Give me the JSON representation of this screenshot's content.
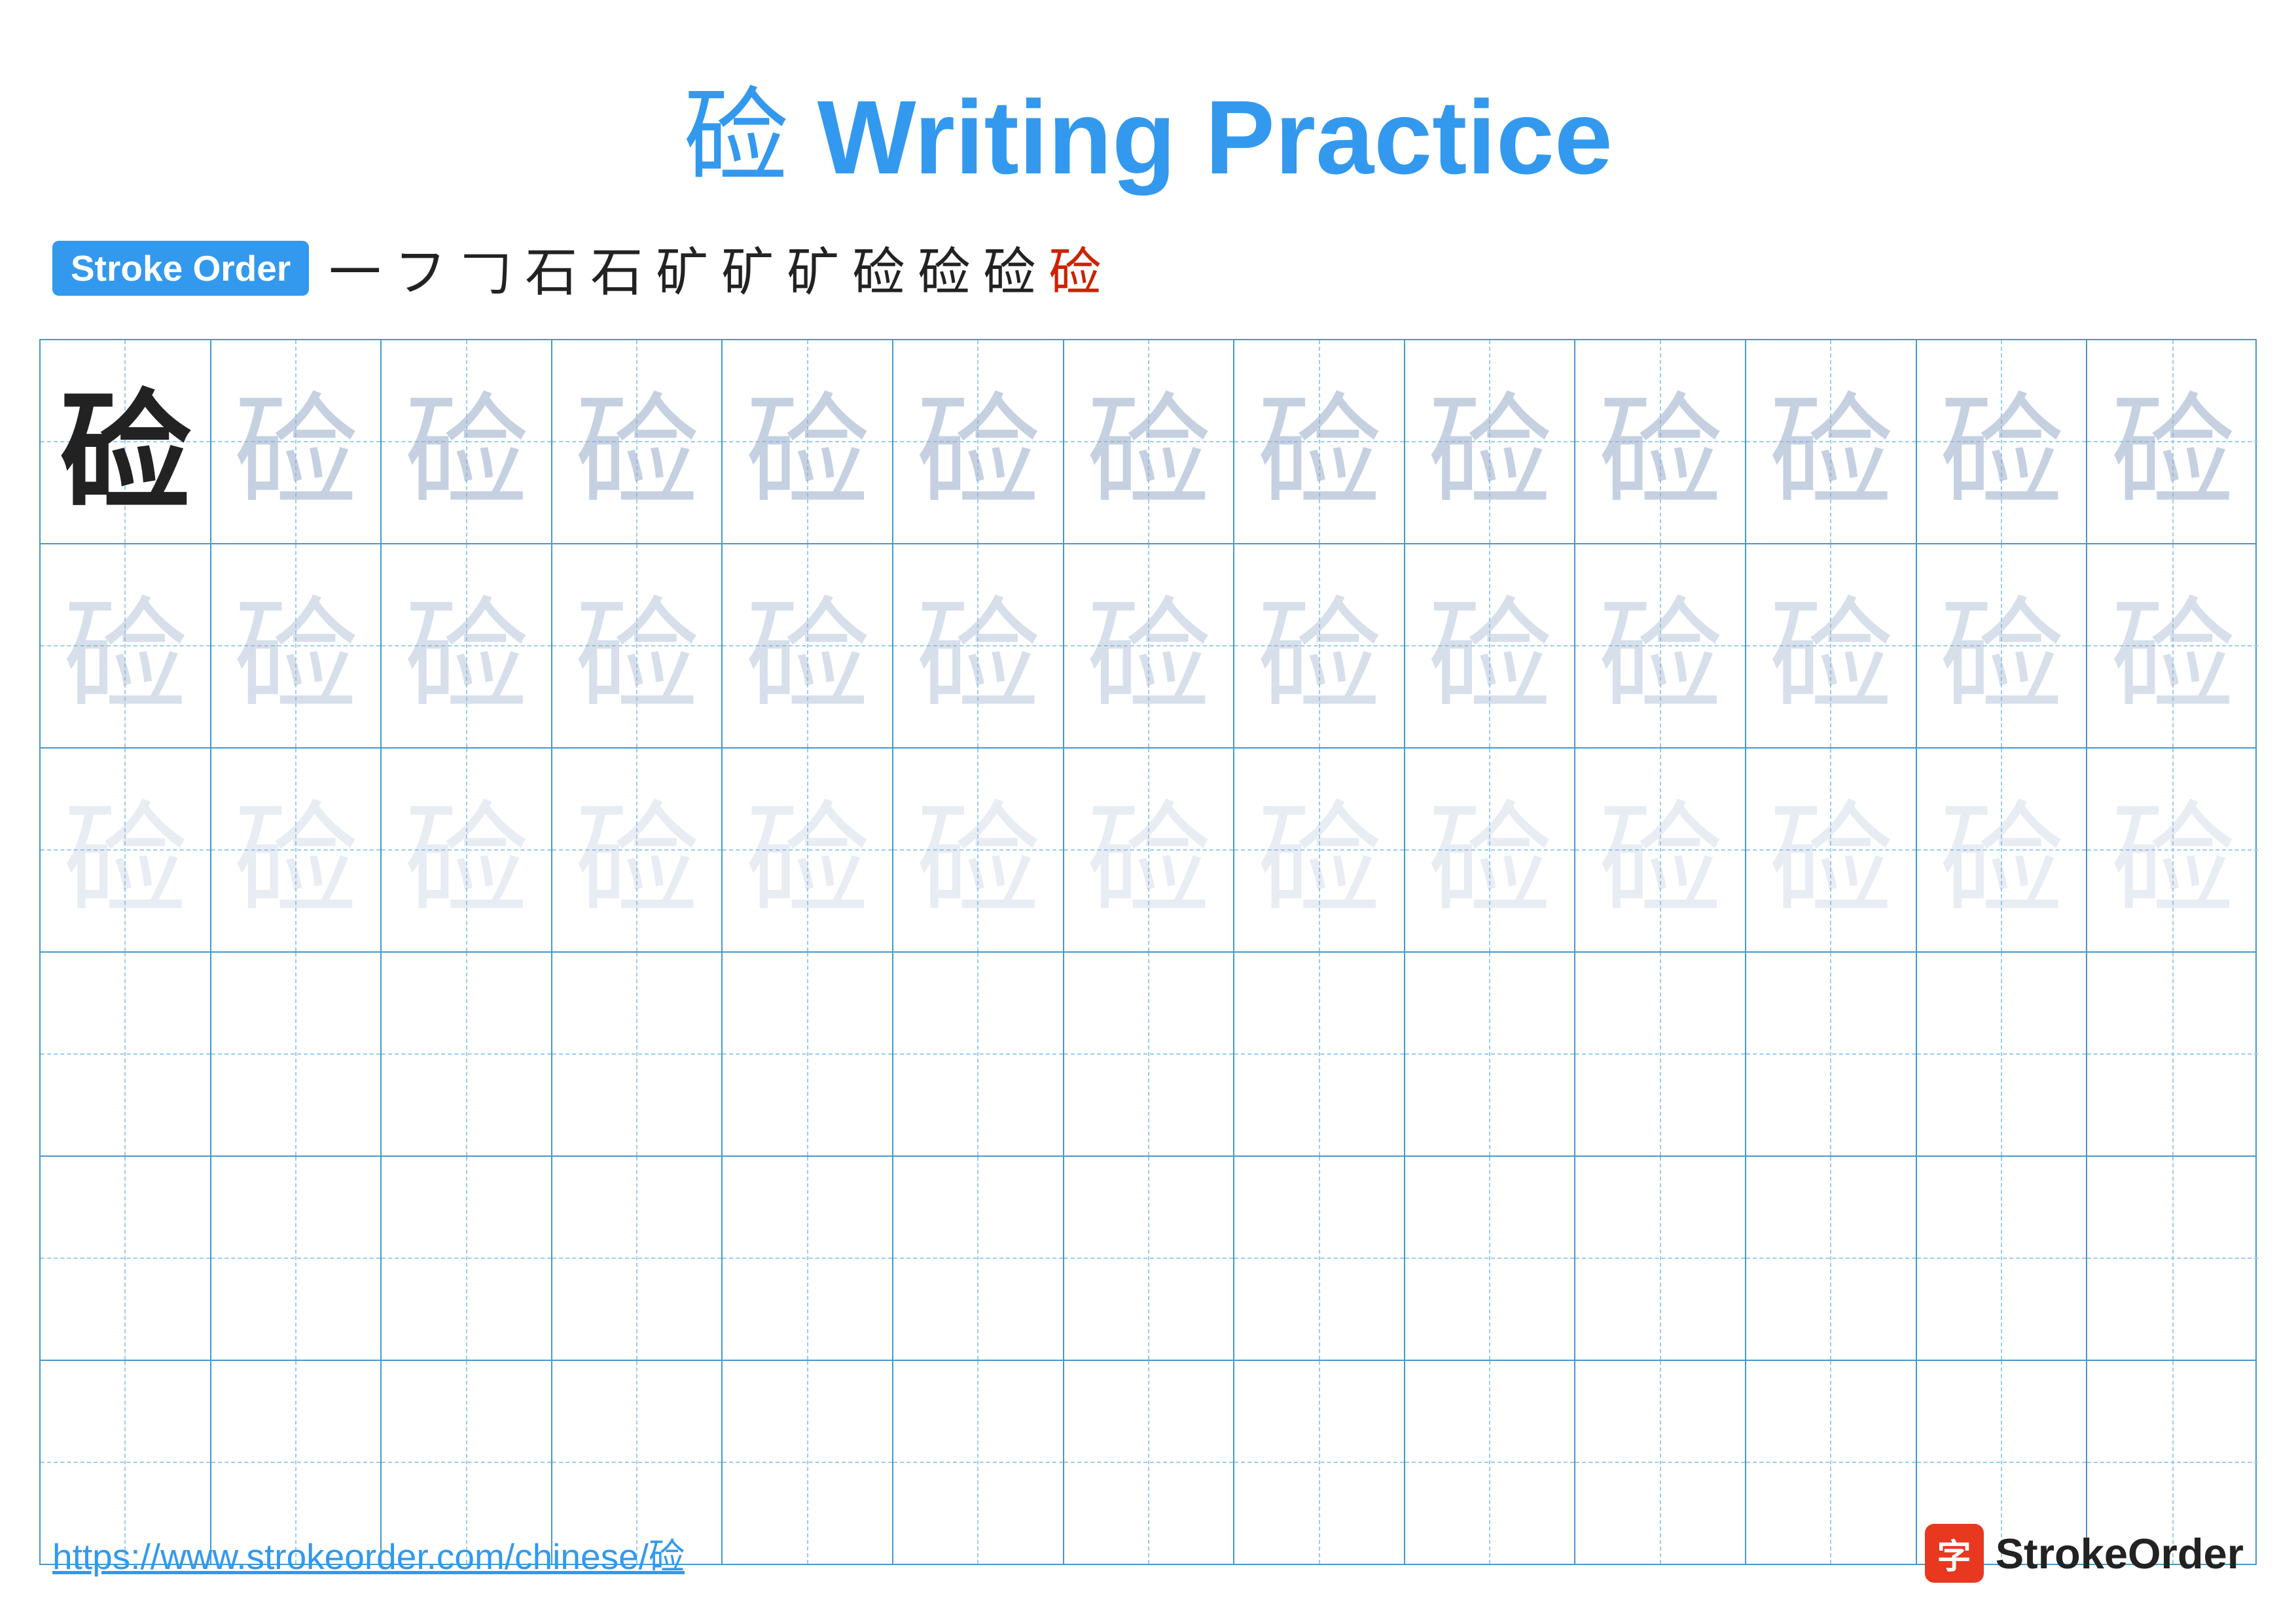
{
  "title": {
    "char": "硷",
    "text": " Writing Practice"
  },
  "stroke_order": {
    "badge_label": "Stroke Order",
    "strokes": [
      "一",
      "フ",
      "𠃌",
      "石",
      "石",
      "矿",
      "矿",
      "矿",
      "硷",
      "硷",
      "硷",
      "硷"
    ]
  },
  "grid": {
    "rows": 6,
    "cols": 13,
    "character": "硷",
    "filled_rows": 3
  },
  "footer": {
    "url": "https://www.strokeorder.com/chinese/硷",
    "logo_char": "字",
    "logo_text": "StrokeOrder"
  }
}
